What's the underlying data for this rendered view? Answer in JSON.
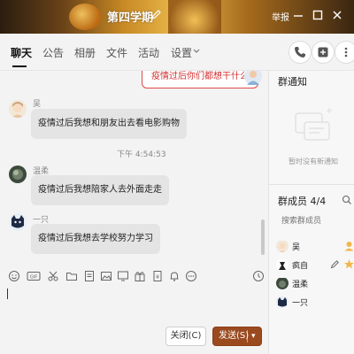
{
  "window": {
    "title": "第四学期",
    "report_label": "举报"
  },
  "tabs": [
    {
      "label": "聊天"
    },
    {
      "label": "公告"
    },
    {
      "label": "相册"
    },
    {
      "label": "文件"
    },
    {
      "label": "活动"
    },
    {
      "label": "设置"
    }
  ],
  "chat": {
    "top_message": "疫情过后你们都想干什么",
    "messages": [
      {
        "sender": "吴",
        "text": "疫情过后我想和朋友出去看电影购物"
      },
      {
        "sender": "温柔",
        "text": "疫情过后我想陪家人去外面走走"
      },
      {
        "sender": "一只",
        "text": "疫情过后我想去学校努力学习"
      }
    ],
    "timestamp": "下午 4:54:53"
  },
  "composer": {
    "close_label": "关闭(C)",
    "send_label": "发送(S)"
  },
  "notice": {
    "title": "群通知",
    "empty_text": "暂时没有新通知"
  },
  "members": {
    "title": "群成员 4/4",
    "search_placeholder": "搜索群成员",
    "list": [
      {
        "name": "吴"
      },
      {
        "name": "疯自"
      },
      {
        "name": "温柔"
      },
      {
        "name": "一只"
      }
    ]
  },
  "colors": {
    "accent": "#9b4a1f",
    "highlight_red": "#e04848"
  }
}
